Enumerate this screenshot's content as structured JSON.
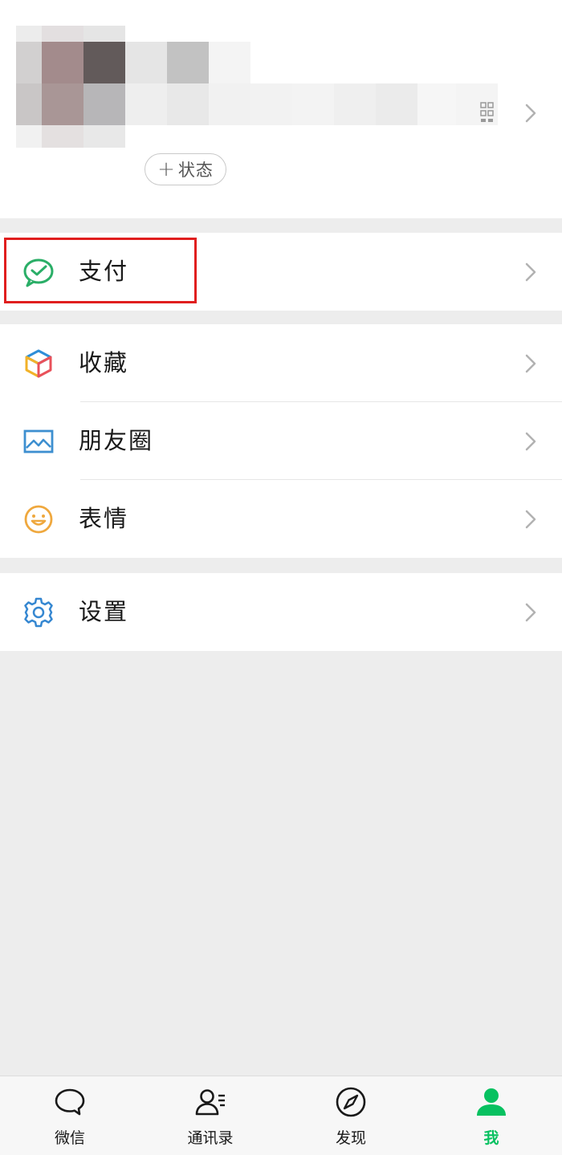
{
  "profile": {
    "status_plus": "+",
    "status_label": "状态"
  },
  "highlight_color": "#e01e1e",
  "menu": {
    "pay": {
      "label": "支付",
      "icon": "wechat-pay-icon"
    },
    "favorites": {
      "label": "收藏",
      "icon": "favorites-cube-icon"
    },
    "moments": {
      "label": "朋友圈",
      "icon": "moments-photo-icon"
    },
    "stickers": {
      "label": "表情",
      "icon": "sticker-smile-icon"
    },
    "settings": {
      "label": "设置",
      "icon": "gear-icon"
    }
  },
  "tabs": [
    {
      "label": "微信",
      "icon": "chat-bubble-icon",
      "active": false
    },
    {
      "label": "通讯录",
      "icon": "contacts-icon",
      "active": false
    },
    {
      "label": "发现",
      "icon": "compass-icon",
      "active": false
    },
    {
      "label": "我",
      "icon": "person-icon",
      "active": true
    }
  ],
  "colors": {
    "accent": "#07c160",
    "background": "#ededed"
  }
}
